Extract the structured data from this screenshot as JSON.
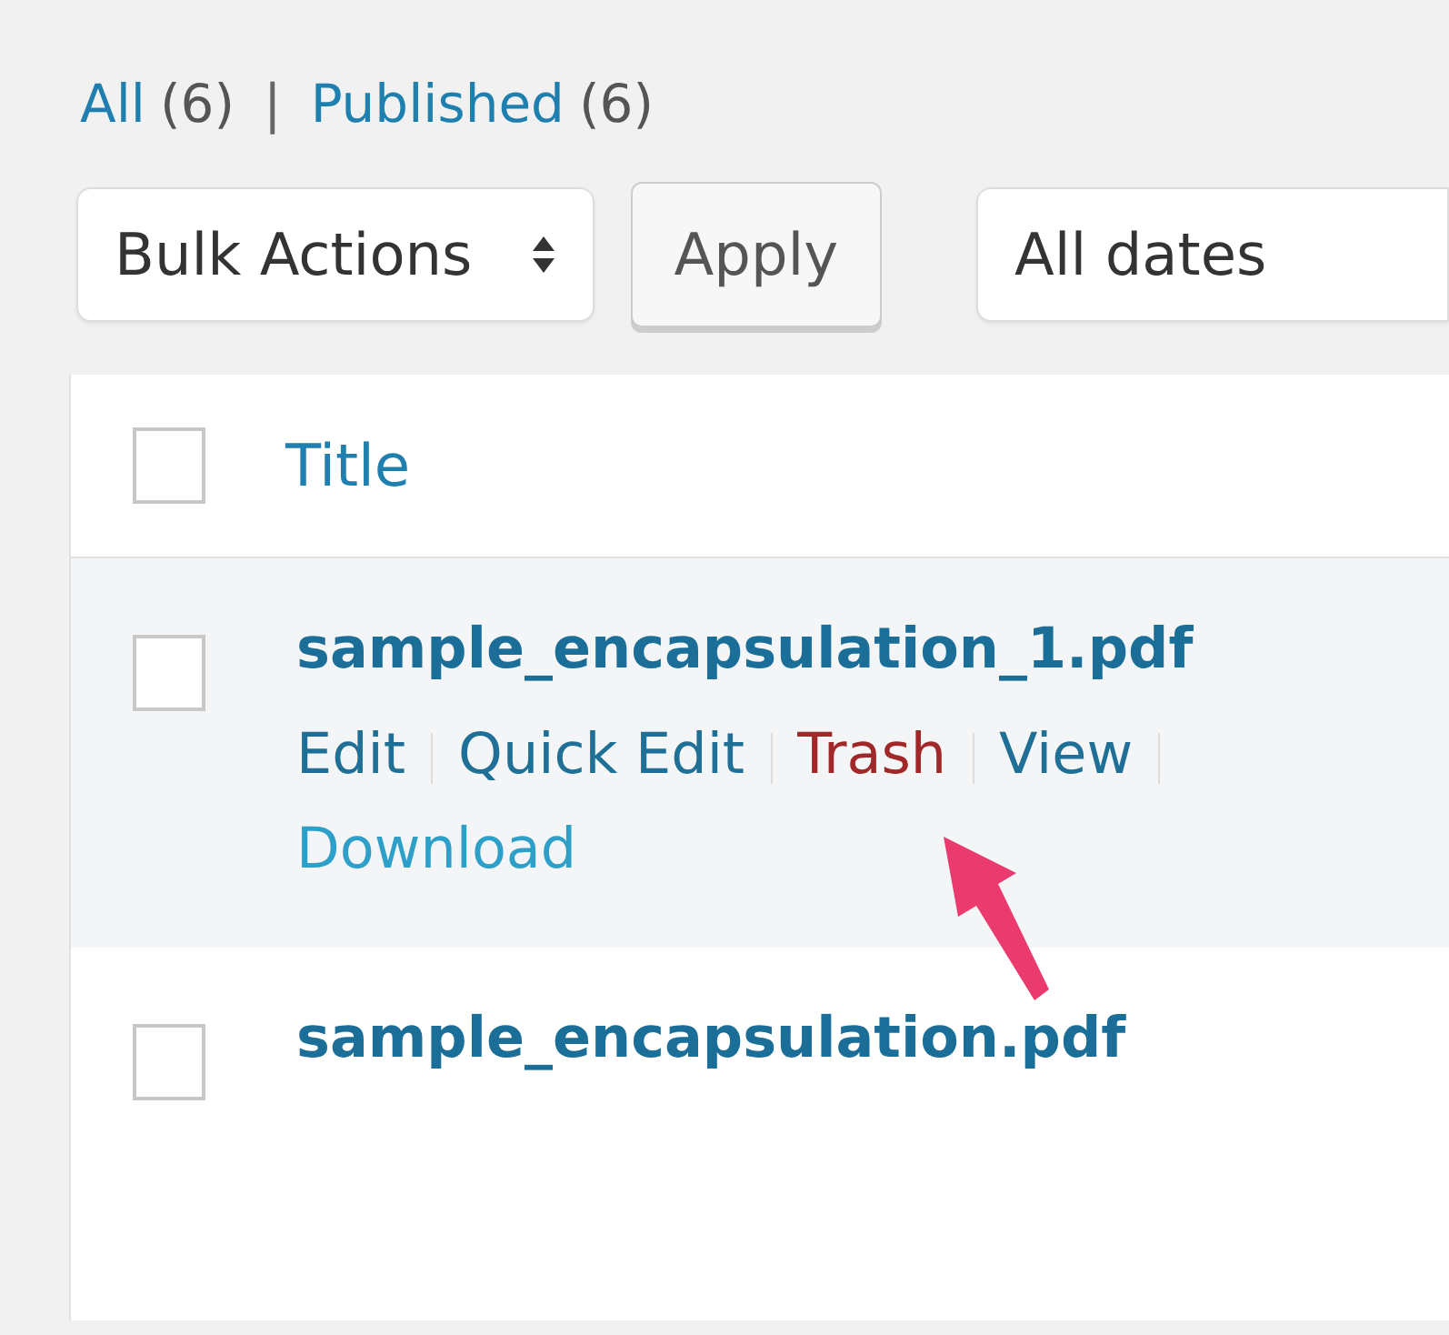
{
  "status_links": [
    {
      "label": "All",
      "count": "(6)"
    },
    {
      "label": "Published",
      "count": "(6)"
    }
  ],
  "separator": "|",
  "bulk_actions": {
    "value": "Bulk Actions"
  },
  "apply_button": "Apply",
  "date_filter": {
    "value": "All dates"
  },
  "table": {
    "header": {
      "checked": false,
      "title": "Title"
    },
    "rows": [
      {
        "title": "sample_encapsulation_1.pdf",
        "checked": false,
        "actions": [
          {
            "label": "Edit",
            "kind": "normal"
          },
          {
            "label": "Quick Edit",
            "kind": "normal"
          },
          {
            "label": "Trash",
            "kind": "danger"
          },
          {
            "label": "View",
            "kind": "normal"
          },
          {
            "label": "Download",
            "kind": "hover"
          }
        ]
      },
      {
        "title": "sample_encapsulation.pdf",
        "checked": false,
        "actions": []
      }
    ]
  },
  "annotation": {
    "kind": "arrow"
  }
}
